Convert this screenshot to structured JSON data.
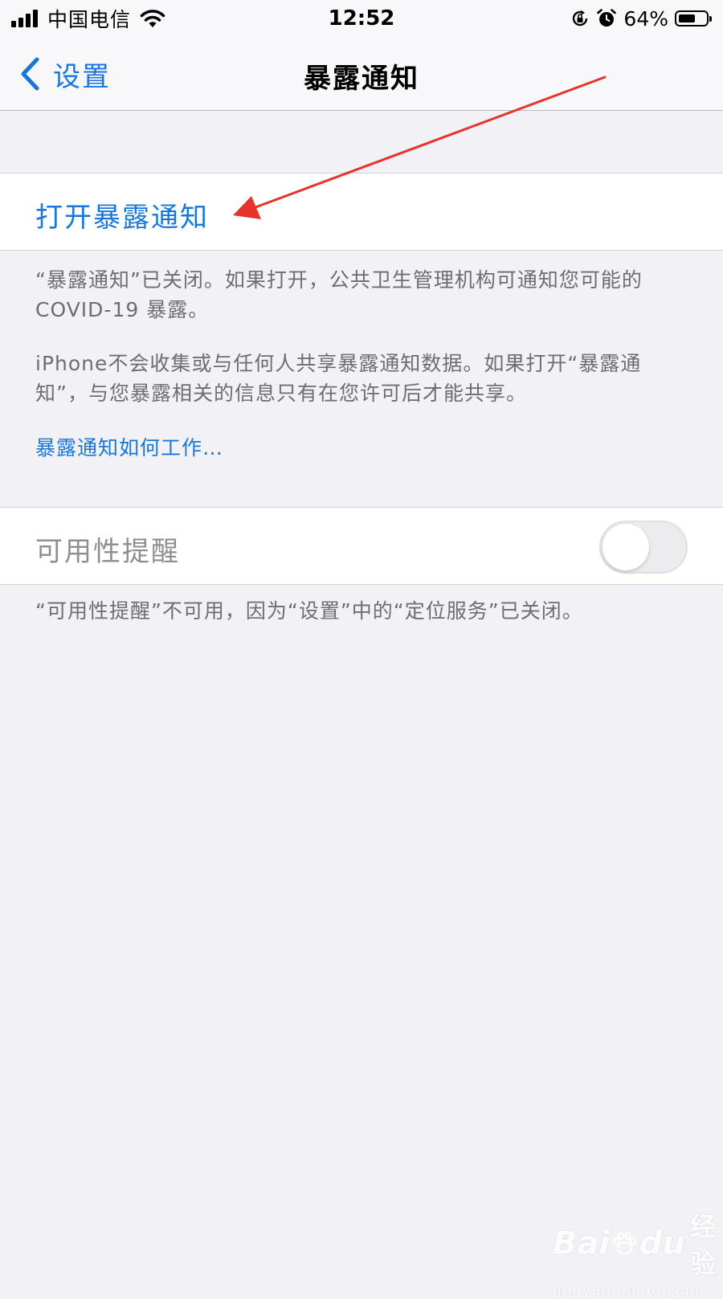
{
  "status_bar": {
    "carrier": "中国电信",
    "time": "12:52",
    "battery_percent": "64%",
    "battery_level": 0.64,
    "icons": [
      "signal-icon",
      "wifi-icon",
      "orientation-lock-icon",
      "alarm-icon",
      "battery-icon"
    ]
  },
  "nav": {
    "back_label": "设置",
    "title": "暴露通知"
  },
  "exposure": {
    "enable_label": "打开暴露通知",
    "footer_1": "“暴露通知”已关闭。如果打开，公共卫生管理机构可通知您可能的COVID-19 暴露。",
    "footer_2": "iPhone不会收集或与任何人共享暴露通知数据。如果打开“暴露通知”，与您暴露相关的信息只有在您许可后才能共享。",
    "how_it_works_link": "暴露通知如何工作…"
  },
  "availability": {
    "label": "可用性提醒",
    "toggle_on": false,
    "footer": "“可用性提醒”不可用，因为“设置”中的“定位服务”已关闭。"
  },
  "colors": {
    "accent": "#1877d8",
    "background": "#f1f1f6",
    "annotation_arrow": "#e8332a"
  },
  "watermark": {
    "brand": "Bai",
    "brand_suffix": "du",
    "brand_cn": "经验",
    "url": "jingyan.baidu.com"
  }
}
